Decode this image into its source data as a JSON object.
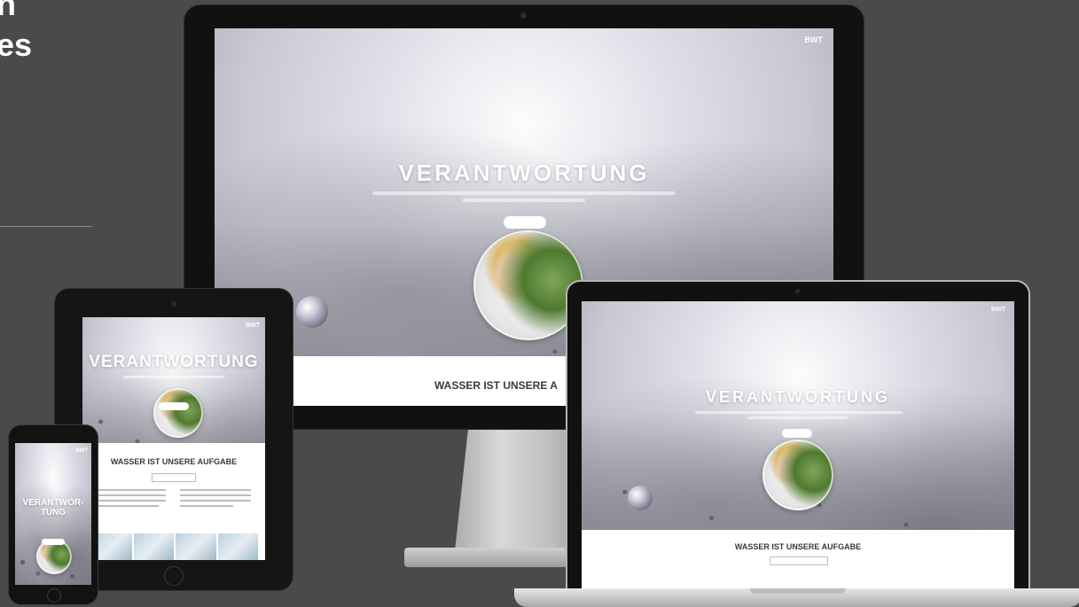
{
  "page": {
    "heading_lines": [
      "n",
      "es"
    ]
  },
  "brand": "BWT",
  "hero": {
    "title": "VERANTWORTUNG",
    "phone_title_line1": "VERANTWOR-",
    "phone_title_line2": "TUNG"
  },
  "section": {
    "title": "WASSER IST UNSERE AUFGABE",
    "monitor_title_visible": "WASSER IST UNSERE A"
  }
}
